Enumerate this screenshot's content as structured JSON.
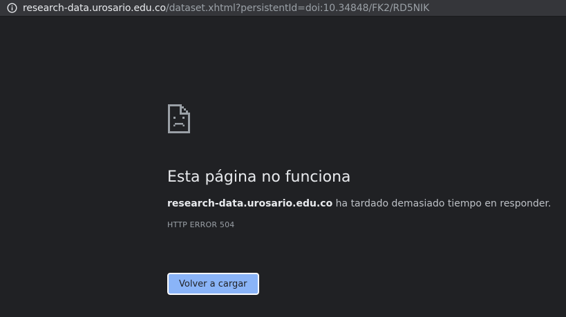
{
  "address_bar": {
    "host": "research-data.urosario.edu.co",
    "path": "/dataset.xhtml?persistentId=doi:10.34848/FK2/RD5NIK",
    "info_icon": "info-icon"
  },
  "error_page": {
    "icon": "sad-document-icon",
    "heading": "Esta página no funciona",
    "site": "research-data.urosario.edu.co",
    "message": " ha tardado demasiado tiempo en responder.",
    "error_code": "HTTP ERROR 504",
    "reload_label": "Volver a cargar"
  },
  "colors": {
    "background": "#202124",
    "button": "#8ab4f8",
    "text": "#e8eaed"
  }
}
